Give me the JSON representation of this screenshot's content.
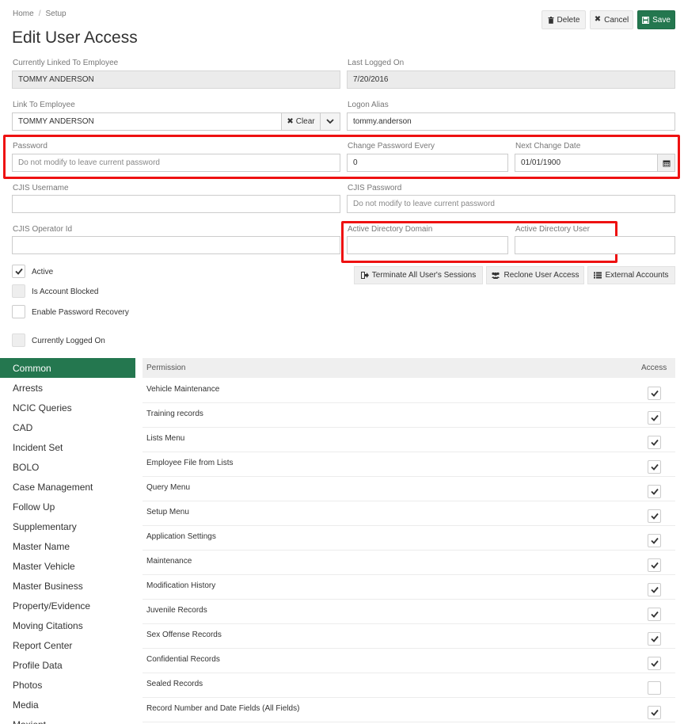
{
  "breadcrumb": {
    "home": "Home",
    "separator": "/",
    "current": "Setup"
  },
  "page_title": "Edit User Access",
  "toolbar": {
    "delete_label": "Delete",
    "cancel_label": "Cancel",
    "save_label": "Save",
    "save_color": "#24774f"
  },
  "form": {
    "linked_employee": {
      "label": "Currently Linked To Employee",
      "value": "TOMMY ANDERSON"
    },
    "last_logged_on": {
      "label": "Last Logged On",
      "value": "7/20/2016"
    },
    "link_to_employee": {
      "label": "Link To Employee",
      "value": "TOMMY ANDERSON",
      "clear_label": "Clear"
    },
    "logon_alias": {
      "label": "Logon Alias",
      "value": "tommy.anderson"
    },
    "password": {
      "label": "Password",
      "placeholder": "Do not modify to leave current password"
    },
    "change_every": {
      "label": "Change Password Every",
      "value": "0"
    },
    "next_change": {
      "label": "Next Change Date",
      "value": "01/01/1900"
    },
    "cjis_username": {
      "label": "CJIS Username",
      "value": ""
    },
    "cjis_password": {
      "label": "CJIS Password",
      "placeholder": "Do not modify to leave current password"
    },
    "cjis_operator": {
      "label": "CJIS Operator Id",
      "value": ""
    },
    "ad_domain": {
      "label": "Active Directory Domain",
      "value": ""
    },
    "ad_user": {
      "label": "Active Directory User",
      "value": ""
    }
  },
  "checkboxes": {
    "active": {
      "label": "Active",
      "checked": true
    },
    "blocked": {
      "label": "Is Account Blocked",
      "checked": false
    },
    "recovery": {
      "label": "Enable Password Recovery",
      "checked": false
    },
    "logged_on": {
      "label": "Currently Logged On",
      "checked": false
    }
  },
  "actions": {
    "terminate": "Terminate All User's Sessions",
    "reclone": "Reclone User Access",
    "external": "External Accounts"
  },
  "sidebar": {
    "items": [
      {
        "label": "Common",
        "active": true
      },
      {
        "label": "Arrests"
      },
      {
        "label": "NCIC Queries"
      },
      {
        "label": "CAD"
      },
      {
        "label": "Incident Set"
      },
      {
        "label": "BOLO"
      },
      {
        "label": "Case Management"
      },
      {
        "label": "Follow Up"
      },
      {
        "label": "Supplementary"
      },
      {
        "label": "Master Name"
      },
      {
        "label": "Master Vehicle"
      },
      {
        "label": "Master Business"
      },
      {
        "label": "Property/Evidence"
      },
      {
        "label": "Moving Citations"
      },
      {
        "label": "Report Center"
      },
      {
        "label": "Profile Data"
      },
      {
        "label": "Photos"
      },
      {
        "label": "Media"
      },
      {
        "label": "Maxient"
      }
    ]
  },
  "permissions": {
    "header_permission": "Permission",
    "header_access": "Access",
    "rows": [
      {
        "name": "Vehicle Maintenance",
        "access": true
      },
      {
        "name": "Training records",
        "access": true
      },
      {
        "name": "Lists Menu",
        "access": true
      },
      {
        "name": "Employee File from Lists",
        "access": true
      },
      {
        "name": "Query Menu",
        "access": true
      },
      {
        "name": "Setup Menu",
        "access": true
      },
      {
        "name": "Application Settings",
        "access": true
      },
      {
        "name": "Maintenance",
        "access": true
      },
      {
        "name": "Modification History",
        "access": true
      },
      {
        "name": "Juvenile Records",
        "access": true
      },
      {
        "name": "Sex Offense Records",
        "access": true
      },
      {
        "name": "Confidential Records",
        "access": true
      },
      {
        "name": "Sealed Records",
        "access": false
      },
      {
        "name": "Record Number and Date Fields (All Fields)",
        "access": true
      }
    ]
  },
  "colors": {
    "accent": "#24774f",
    "highlight": "#ee1111"
  }
}
